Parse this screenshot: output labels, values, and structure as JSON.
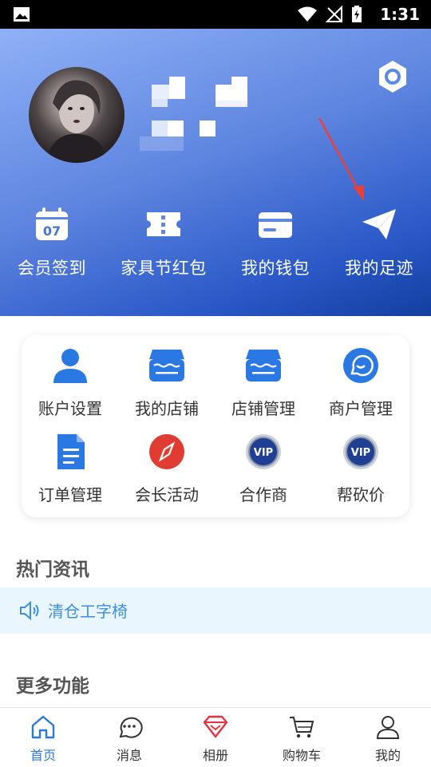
{
  "status_bar": {
    "time": "1:31"
  },
  "hero": {
    "quick_actions": [
      {
        "label": "会员签到",
        "icon": "calendar-icon",
        "day": "07"
      },
      {
        "label": "家具节红包",
        "icon": "ticket-icon"
      },
      {
        "label": "我的钱包",
        "icon": "wallet-card-icon"
      },
      {
        "label": "我的足迹",
        "icon": "paper-plane-icon"
      }
    ]
  },
  "grid": [
    {
      "label": "账户设置",
      "icon": "user-icon"
    },
    {
      "label": "我的店铺",
      "icon": "store-icon"
    },
    {
      "label": "店铺管理",
      "icon": "store-icon"
    },
    {
      "label": "商户管理",
      "icon": "chat-smile-icon"
    },
    {
      "label": "订单管理",
      "icon": "document-icon"
    },
    {
      "label": "会长活动",
      "icon": "compass-icon"
    },
    {
      "label": "合作商",
      "icon": "vip-badge-icon",
      "badge": "VIP"
    },
    {
      "label": "帮砍价",
      "icon": "vip-badge-icon",
      "badge": "VIP"
    }
  ],
  "hot_news": {
    "title": "热门资讯",
    "item": "清仓工字椅"
  },
  "more": {
    "title": "更多功能"
  },
  "tabs": [
    {
      "label": "首页",
      "icon": "home-icon",
      "active": true
    },
    {
      "label": "消息",
      "icon": "message-icon"
    },
    {
      "label": "相册",
      "icon": "diamond-icon"
    },
    {
      "label": "购物车",
      "icon": "cart-icon"
    },
    {
      "label": "我的",
      "icon": "profile-icon"
    }
  ],
  "colors": {
    "primary": "#2a78e4",
    "hero_start": "#8fb1f7",
    "hero_end": "#123f9f",
    "compass_red": "#e03c31",
    "diamond_red": "#e8313e"
  }
}
